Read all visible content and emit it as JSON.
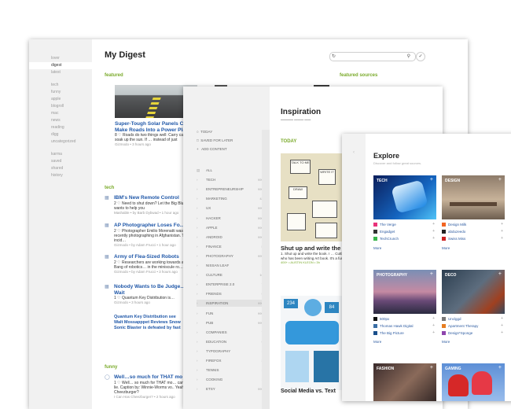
{
  "digest": {
    "sidebar": [
      "lover",
      "digest",
      "latest",
      "tech",
      "funny",
      "apple",
      "blogroll",
      "mac",
      "news",
      "reading",
      "digg",
      "uncategorized",
      "karma",
      "saved",
      "shared",
      "history"
    ],
    "active": "digest",
    "title": "My Digest",
    "featured_label": "featured",
    "featured_sources_label": "featured sources",
    "featured_article": {
      "title": "Super-Tough Solar Panels Could Make Roads Into a Power Plant",
      "snippet": "8 ♡ Roads do two things well: Carry cars, and soak up the sun. If … instead of just",
      "source": "Gizmodo • 3 hours ago"
    },
    "tech_label": "tech",
    "tech_articles": [
      {
        "title": "IBM's New Remote Control",
        "snippet": "2 ♡ Need to shut down? Let the Big Blue wants to help you",
        "source": "Mashable • by Barb Dybwad • 1 hour ago"
      },
      {
        "title": "AP Photographer Loses Fo…",
        "snippet": "2 ♡ Photographer Emilio Morenatti was recently photographing in Afghanistan. The incid…",
        "source": "Gizmodo • by Adam Frucci • 1 hour ago"
      },
      {
        "title": "Army of Flea-Sized Robots",
        "snippet": "2 ♡ Researchers are working towards a Big Bang of robotics… in the miniscule ro…",
        "source": "Gizmodo • by Adam Frucci • 3 hours ago"
      },
      {
        "title": "Nobody Wants to Be Judge… Wait",
        "snippet": "1 ♡ Quantum Key Distribution is…",
        "source": "Gizmodo • 3 hours ago"
      }
    ],
    "extra_links": [
      "Quantum Key Distribution see",
      "Walt Mossapppet Reviews Snow",
      "Sonic Blaster is defeated by fast"
    ],
    "funny_label": "funny",
    "funny_articles": [
      {
        "title": "Well…so much for THAT mo",
        "snippet": "1 ♡ Well… so much for THAT mo… can't lie. Caption by: Winnie-Worms vo.. Yeah! Cheezburger?",
        "source": "I Can Has Cheezburger? • 2 hours ago"
      },
      {
        "title": "Have you hacked my laptop",
        "snippet": "",
        "source": ""
      }
    ]
  },
  "inspiration": {
    "top_nav": [
      "TODAY",
      "SAVED FOR LATER",
      "ADD CONTENT"
    ],
    "nav": [
      {
        "label": "ALL",
        "count": ""
      },
      {
        "label": "TECH",
        "count": "999+"
      },
      {
        "label": "ENTREPRENEURSHIP",
        "count": "999+"
      },
      {
        "label": "MARKETING",
        "count": "422"
      },
      {
        "label": "UX",
        "count": "999+"
      },
      {
        "label": "HACKER",
        "count": "999+"
      },
      {
        "label": "APPLE",
        "count": "999+"
      },
      {
        "label": "ANDROID",
        "count": "999+"
      },
      {
        "label": "FINANCE",
        "count": "53"
      },
      {
        "label": "PHOTOGRAPHY",
        "count": "999+"
      },
      {
        "label": "NISSAN LEAF",
        "count": "17"
      },
      {
        "label": "CULTURE",
        "count": "107"
      },
      {
        "label": "ENTERPRISE 2.0",
        "count": "73"
      },
      {
        "label": "FRIENDS",
        "count": "99"
      },
      {
        "label": "INSPIRATION",
        "count": "999+"
      },
      {
        "label": "FUN",
        "count": "999+"
      },
      {
        "label": "PUB",
        "count": "999+"
      },
      {
        "label": "COMPANIES",
        "count": "78"
      },
      {
        "label": "EDUCATION",
        "count": "99"
      },
      {
        "label": "TYPOGRAPHY",
        "count": "17"
      },
      {
        "label": "FIREFOX",
        "count": "36"
      },
      {
        "label": "TENNIS",
        "count": "17"
      },
      {
        "label": "COOKING",
        "count": "17"
      },
      {
        "label": "ETSY",
        "count": "999+"
      }
    ],
    "selected": "INSPIRATION",
    "title": "Inspiration",
    "today_label": "TODAY",
    "sketch_words": [
      "TALK TO ME",
      "WRITE IT",
      "DRAW"
    ],
    "article1": {
      "title": "Shut up and write the",
      "snippet": "1. Shut up and write the book. I … Cuttlefish, who has been writing Art book. It's a fun read…",
      "source": "400+ • AUSTIN KLEON • 3h"
    },
    "info_numbers": [
      "234",
      "84"
    ],
    "article2": "Social Media vs. Text"
  },
  "explore": {
    "title": "Explore",
    "subtitle": "Discover and follow great sources.",
    "tiles": [
      {
        "label": "TECH",
        "sources": [
          {
            "name": "The Verge",
            "color": "#e9327a"
          },
          {
            "name": "Engadget",
            "color": "#333333"
          },
          {
            "name": "TechCrunch",
            "color": "#39b54a"
          }
        ],
        "more": "More"
      },
      {
        "label": "DESIGN",
        "sources": [
          {
            "name": "Design Milk",
            "color": "#f26522"
          },
          {
            "name": "abduzeedo",
            "color": "#222222"
          },
          {
            "name": "Swiss Miss",
            "color": "#cc2222"
          }
        ],
        "more": "More"
      },
      {
        "label": "PHOTOGRAPHY",
        "sources": [
          {
            "name": "500px",
            "color": "#111111"
          },
          {
            "name": "Thomas Hawk Digital",
            "color": "#3a6ea5"
          },
          {
            "name": "The Big Picture",
            "color": "#1a4f8b"
          }
        ],
        "more": "More"
      },
      {
        "label": "DECO",
        "sources": [
          {
            "name": "Unclggd",
            "color": "#777777"
          },
          {
            "name": "Apartment Therapy",
            "color": "#e67e22"
          },
          {
            "name": "Design*Sponge",
            "color": "#8e44ad"
          }
        ],
        "more": "More"
      },
      {
        "label": "FASHION",
        "sources": [],
        "more": ""
      },
      {
        "label": "GAMING",
        "sources": [],
        "more": ""
      }
    ]
  }
}
